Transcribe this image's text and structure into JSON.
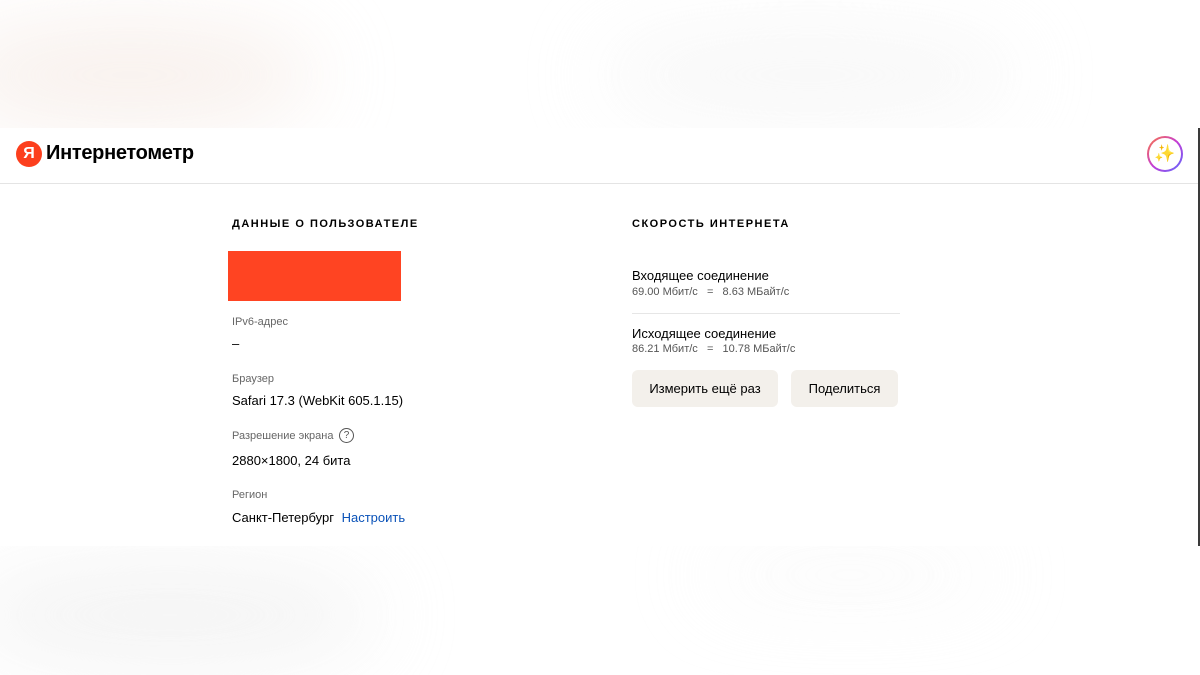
{
  "header": {
    "logo_letter": "Я",
    "brand_name": "Интернетометр",
    "avatar_icon": "sparkles-icon"
  },
  "user_data": {
    "title": "ДАННЫЕ О ПОЛЬЗОВАТЕЛЕ",
    "ipv6_label": "IPv6-адрес",
    "ipv6_value": "–",
    "browser_label": "Браузер",
    "browser_value": "Safari 17.3 (WebKit 605.1.15)",
    "resolution_label": "Разрешение экрана",
    "resolution_value": "2880×1800, 24 бита",
    "region_label": "Регион",
    "region_value": "Санкт-Петербург",
    "region_link": "Настроить"
  },
  "speed": {
    "title": "СКОРОСТЬ ИНТЕРНЕТА",
    "incoming_title": "Входящее соединение",
    "incoming_value": "69.00 Мбит/с   =   8.63 МБайт/с",
    "outgoing_title": "Исходящее соединение",
    "outgoing_value": "86.21 Мбит/с   =   10.78 МБайт/с",
    "remeasure_label": "Измерить ещё раз",
    "share_label": "Поделиться"
  },
  "colors": {
    "brand_red": "#fc3f1d",
    "redaction": "#ff4422",
    "link": "#0a52b8",
    "button_bg": "#f3f0eb"
  }
}
